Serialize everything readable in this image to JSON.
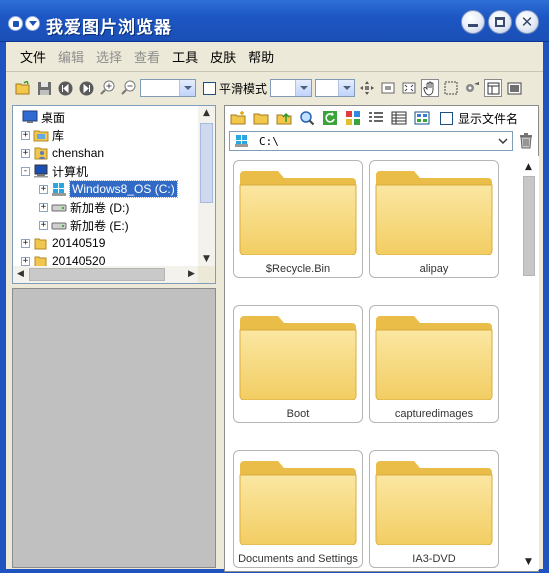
{
  "window": {
    "title": "我爱图片浏览器",
    "colors": {
      "titlebar": "#1d57c4",
      "selection": "#316ac5",
      "folder": "#f6da7c"
    }
  },
  "menu": [
    {
      "label": "文件",
      "enabled": true
    },
    {
      "label": "编辑",
      "enabled": false
    },
    {
      "label": "选择",
      "enabled": false
    },
    {
      "label": "查看",
      "enabled": false
    },
    {
      "label": "工具",
      "enabled": true
    },
    {
      "label": "皮肤",
      "enabled": true
    },
    {
      "label": "帮助",
      "enabled": true
    }
  ],
  "toolbar": {
    "smooth_mode_label": "平滑模式",
    "icons": [
      "open-folder-icon",
      "save-icon",
      "first-icon",
      "last-icon",
      "zoom-in-icon",
      "zoom-out-icon",
      "fit-icon",
      "actual-size-icon",
      "fullscreen-icon",
      "hand-icon",
      "select-icon",
      "settings-icon",
      "view-icon",
      "slideshow-icon"
    ]
  },
  "tree": {
    "items": [
      {
        "label": "桌面",
        "icon": "desktop-icon",
        "level": 0,
        "expander": ""
      },
      {
        "label": "库",
        "icon": "library-icon",
        "level": 1,
        "expander": "+"
      },
      {
        "label": "chenshan",
        "icon": "user-icon",
        "level": 1,
        "expander": "+"
      },
      {
        "label": "计算机",
        "icon": "computer-icon",
        "level": 1,
        "expander": "-"
      },
      {
        "label": "Windows8_OS (C:)",
        "icon": "windows-drive-icon",
        "level": 2,
        "expander": "+",
        "selected": true
      },
      {
        "label": "新加卷 (D:)",
        "icon": "drive-icon",
        "level": 2,
        "expander": "+"
      },
      {
        "label": "新加卷 (E:)",
        "icon": "drive-icon",
        "level": 2,
        "expander": "+"
      },
      {
        "label": "20140519",
        "icon": "folder-icon",
        "level": 1,
        "expander": "+"
      },
      {
        "label": "20140520",
        "icon": "folder-icon",
        "level": 1,
        "expander": "+"
      }
    ]
  },
  "right": {
    "show_filename_label": "显示文件名",
    "path": "C:\\",
    "folders": [
      {
        "name": "$Recycle.Bin"
      },
      {
        "name": "alipay"
      },
      {
        "name": "Boot"
      },
      {
        "name": "capturedimages"
      },
      {
        "name": "Documents and Settings"
      },
      {
        "name": "IA3-DVD"
      }
    ]
  }
}
